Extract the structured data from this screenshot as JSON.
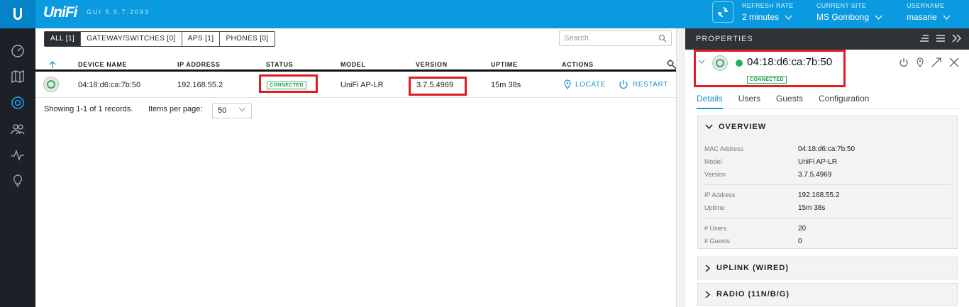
{
  "header": {
    "brand": "UniFi",
    "gui_version": "GUI 5.0.7.2093",
    "refresh_rate_label": "REFRESH RATE",
    "refresh_rate_value": "2 minutes",
    "current_site_label": "CURRENT SITE",
    "current_site_value": "MS Gombong",
    "username_label": "USERNAME",
    "username_value": "masarie"
  },
  "sidebar": {
    "items": [
      {
        "icon": "dashboard-icon"
      },
      {
        "icon": "map-icon"
      },
      {
        "icon": "devices-icon"
      },
      {
        "icon": "clients-icon"
      },
      {
        "icon": "statistics-icon"
      },
      {
        "icon": "insights-icon"
      }
    ]
  },
  "filters": {
    "tabs": [
      "ALL [1]",
      "GATEWAY/SWITCHES [0]",
      "APS [1]",
      "PHONES [0]"
    ],
    "search_placeholder": "Search"
  },
  "table": {
    "columns": [
      "DEVICE NAME",
      "IP ADDRESS",
      "STATUS",
      "MODEL",
      "VERSION",
      "UPTIME",
      "ACTIONS"
    ],
    "rows": [
      {
        "device_name": "04:18:d6:ca:7b:50",
        "ip": "192.168.55.2",
        "status": "CONNECTED",
        "model": "UniFi AP-LR",
        "version": "3.7.5.4969",
        "uptime": "15m 38s",
        "locate_label": "LOCATE",
        "restart_label": "RESTART"
      }
    ],
    "summary": "Showing 1-1 of 1 records.",
    "items_per_page_label": "Items per page:",
    "items_per_page_value": "50"
  },
  "properties": {
    "title": "PROPERTIES",
    "device_mac": "04:18:d6:ca:7b:50",
    "device_status": "CONNECTED",
    "tabs": [
      "Details",
      "Users",
      "Guests",
      "Configuration"
    ],
    "overview_title": "OVERVIEW",
    "overview": {
      "mac_label": "MAC Address",
      "mac_value": "04:18:d6:ca:7b:50",
      "model_label": "Model",
      "model_value": "UniFi AP-LR",
      "version_label": "Version",
      "version_value": "3.7.5.4969",
      "ip_label": "IP Address",
      "ip_value": "192.168.55.2",
      "uptime_label": "Uptime",
      "uptime_value": "15m 38s",
      "users_label": "# Users",
      "users_value": "20",
      "guests_label": "# Guests",
      "guests_value": "0"
    },
    "uplink_title": "UPLINK (WIRED)",
    "radio_title": "RADIO (11N/B/G)"
  },
  "colors": {
    "topbar": "#0a9ae0",
    "sidebar": "#1b2126",
    "accent": "#1e8fc8",
    "connected": "#1d9b4c",
    "highlight": "#e21b24"
  }
}
